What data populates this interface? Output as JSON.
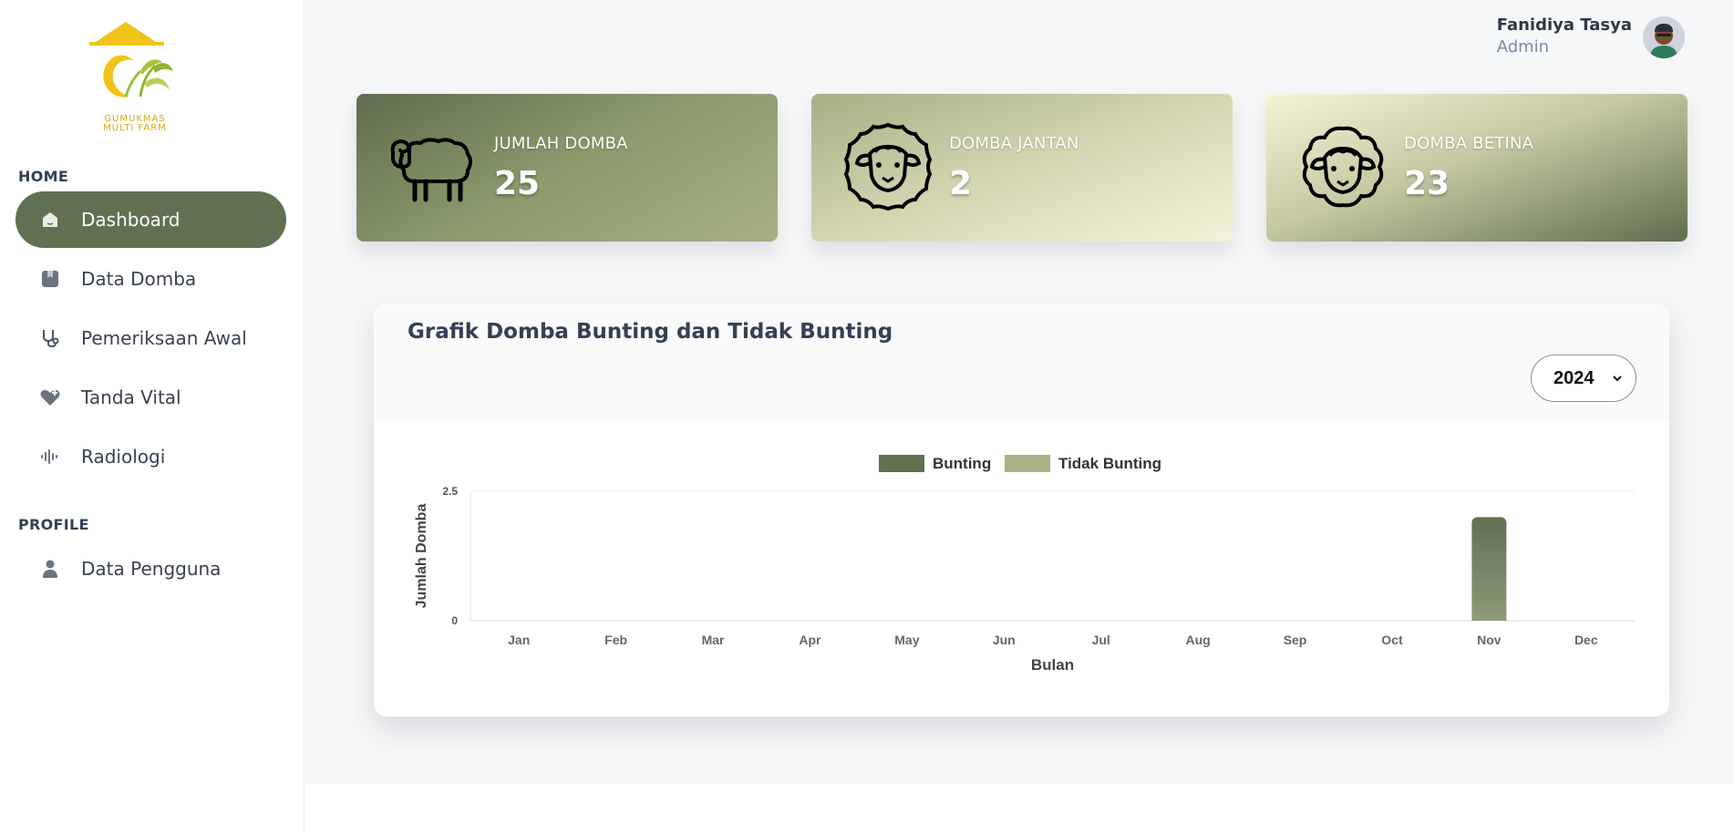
{
  "sidebar": {
    "logo_text_line1": "GUMUKMAS",
    "logo_text_line2": "MULTI FARM",
    "sections": [
      {
        "label": "HOME"
      },
      {
        "label": "PROFILE"
      }
    ],
    "items": [
      {
        "label": "Dashboard",
        "icon": "home-icon",
        "active": true
      },
      {
        "label": "Data Domba",
        "icon": "bookmark-icon",
        "active": false
      },
      {
        "label": "Pemeriksaan Awal",
        "icon": "stethoscope-icon",
        "active": false
      },
      {
        "label": "Tanda Vital",
        "icon": "heart-plus-icon",
        "active": false
      },
      {
        "label": "Radiologi",
        "icon": "waveform-icon",
        "active": false
      },
      {
        "label": "Data Pengguna",
        "icon": "user-icon",
        "active": false
      }
    ]
  },
  "header": {
    "user_name": "Fanidiya Tasya",
    "user_role": "Admin"
  },
  "cards": [
    {
      "title": "JUMLAH DOMBA",
      "value": "25",
      "icon": "sheep-icon"
    },
    {
      "title": "DOMBA JANTAN",
      "value": "2",
      "icon": "ram-face-icon"
    },
    {
      "title": "DOMBA BETINA",
      "value": "23",
      "icon": "ewe-face-icon"
    }
  ],
  "chart_panel": {
    "title": "Grafik Domba Bunting dan Tidak Bunting",
    "year_selected": "2024"
  },
  "colors": {
    "accent": "#617050",
    "series_bunting": "#617050",
    "series_tidak_bunting": "#a9b386"
  },
  "chart_data": {
    "type": "bar",
    "categories": [
      "Jan",
      "Feb",
      "Mar",
      "Apr",
      "May",
      "Jun",
      "Jul",
      "Aug",
      "Sep",
      "Oct",
      "Nov",
      "Dec"
    ],
    "series": [
      {
        "name": "Bunting",
        "values": [
          0,
          0,
          0,
          0,
          0,
          0,
          0,
          0,
          0,
          0,
          2,
          0
        ]
      },
      {
        "name": "Tidak Bunting",
        "values": [
          0,
          0,
          0,
          0,
          0,
          0,
          0,
          0,
          0,
          0,
          0,
          0
        ]
      }
    ],
    "xlabel": "Bulan",
    "ylabel": "Jumlah Domba",
    "ylim": [
      0,
      2.5
    ],
    "yticks": [
      "0",
      "2.5"
    ],
    "legend": "top-center",
    "grid": false
  }
}
